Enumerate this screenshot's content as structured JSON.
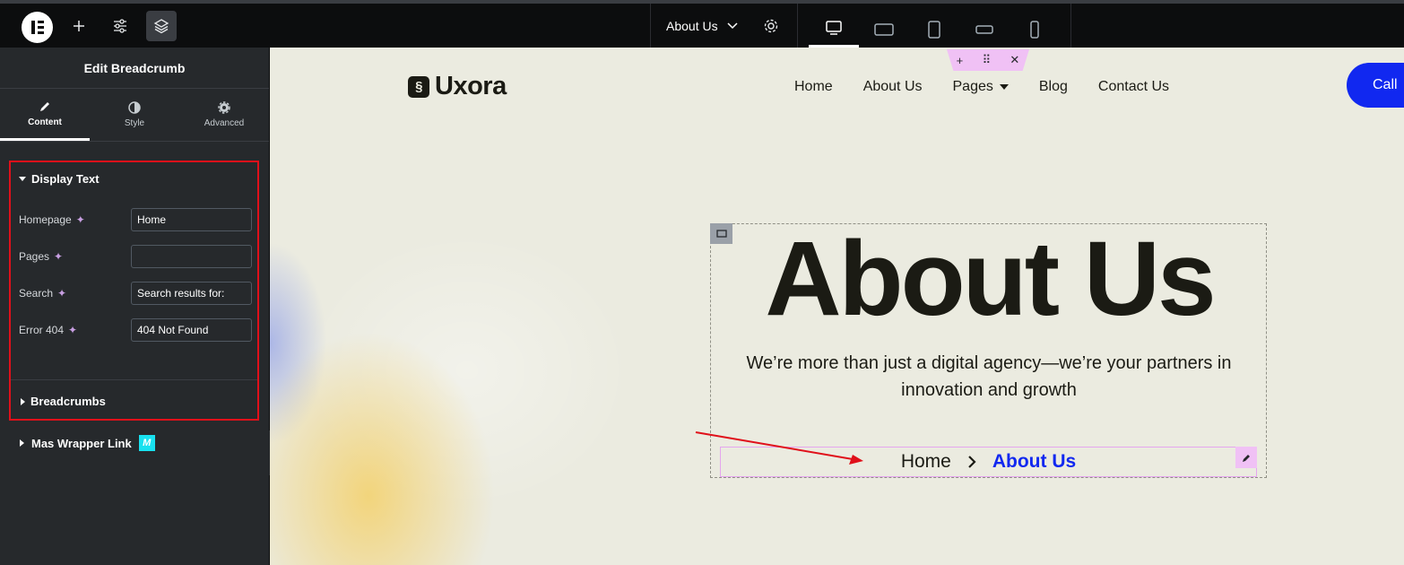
{
  "topbar": {
    "page_name": "About Us"
  },
  "panel": {
    "title": "Edit Breadcrumb",
    "tabs": [
      "Content",
      "Style",
      "Advanced"
    ],
    "display_text": {
      "heading": "Display Text",
      "fields": [
        {
          "label": "Homepage",
          "value": "Home"
        },
        {
          "label": "Pages",
          "value": ""
        },
        {
          "label": "Search",
          "value": "Search results for:"
        },
        {
          "label": "Error 404",
          "value": "404 Not Found"
        }
      ]
    },
    "breadcrumbs_heading": "Breadcrumbs",
    "mas_wrapper": {
      "label": "Mas Wrapper Link",
      "badge": "M"
    }
  },
  "site": {
    "logo": "Uxora",
    "nav": [
      "Home",
      "About Us",
      "Pages",
      "Blog",
      "Contact Us"
    ],
    "cta": "Call",
    "hero_title": "About Us",
    "hero_subtitle": "We’re more than just a digital agency—we’re your partners in innovation and growth",
    "breadcrumb": {
      "home": "Home",
      "separator": "›",
      "current": "About Us"
    }
  },
  "colors": {
    "accent_blue": "#1128f0",
    "highlight_red": "#e0101a",
    "editor_pink": "#f0c1f5",
    "canvas_bg": "#ebebe0"
  }
}
